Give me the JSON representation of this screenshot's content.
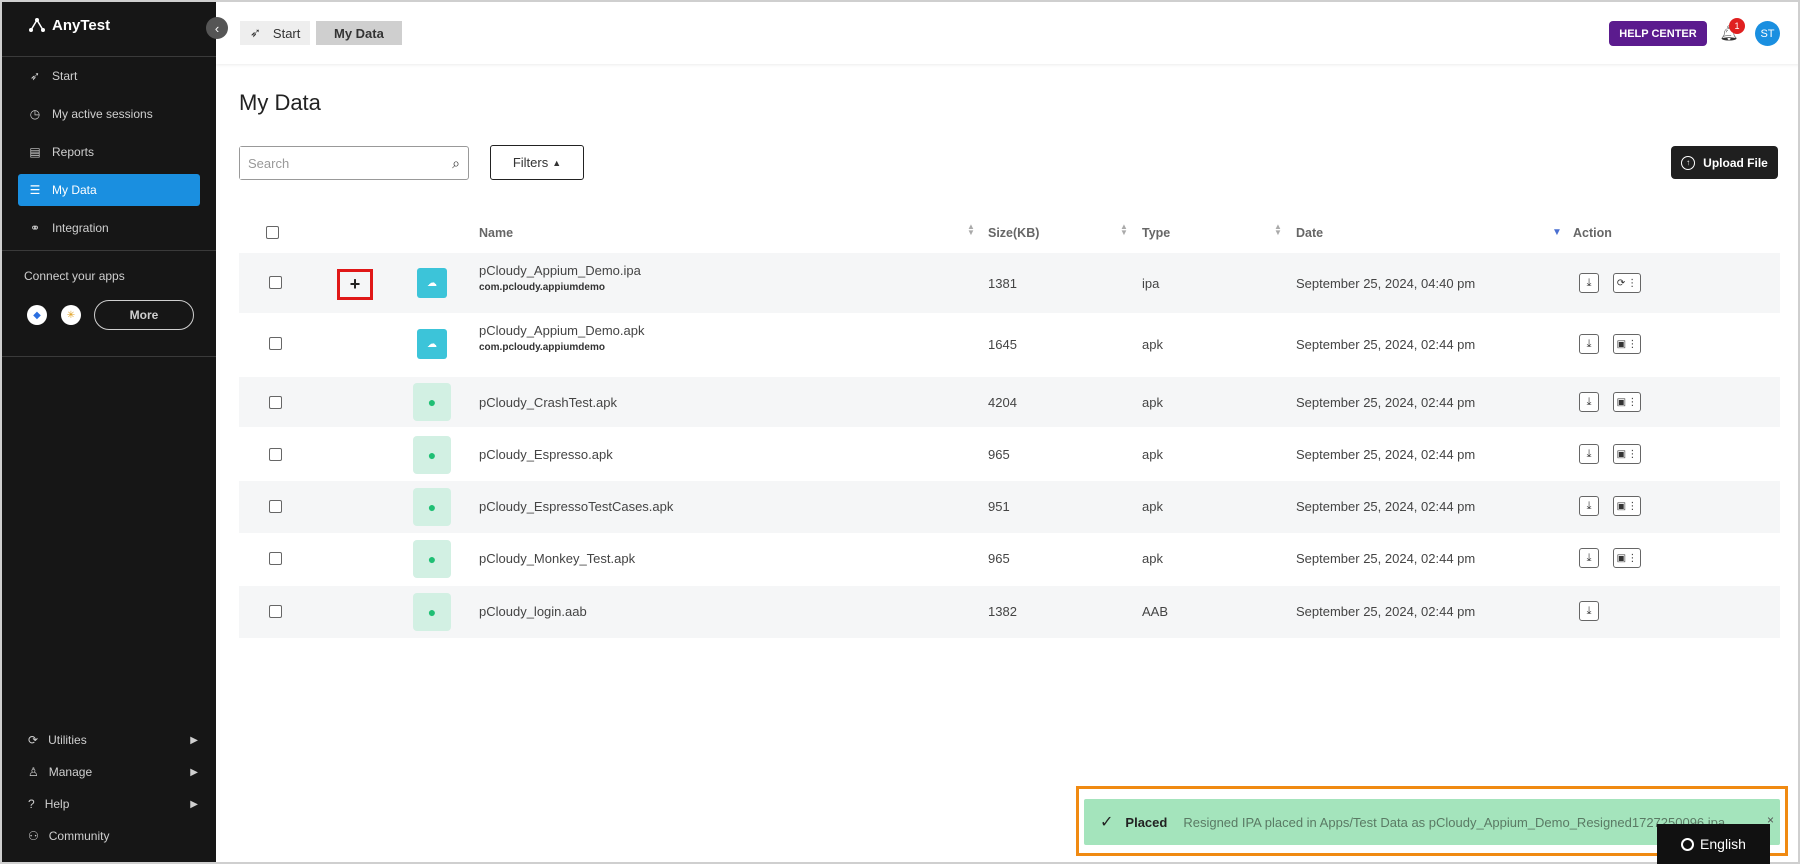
{
  "app": {
    "brand": "AnyTest",
    "accent": "#1a8fe0"
  },
  "sidebar": {
    "items": [
      {
        "label": "Start",
        "icon": "rocket-icon"
      },
      {
        "label": "My active sessions",
        "icon": "clock-icon"
      },
      {
        "label": "Reports",
        "icon": "report-icon"
      },
      {
        "label": "My Data",
        "icon": "database-icon",
        "active": true
      },
      {
        "label": "Integration",
        "icon": "integration-icon"
      }
    ],
    "connect_label": "Connect your apps",
    "more_label": "More",
    "bottom": [
      {
        "label": "Utilities",
        "icon": "utilities-icon"
      },
      {
        "label": "Manage",
        "icon": "user-icon"
      },
      {
        "label": "Help",
        "icon": "help-icon"
      },
      {
        "label": "Community",
        "icon": "community-icon"
      }
    ]
  },
  "header": {
    "breadcrumb": {
      "start": "Start",
      "current": "My Data"
    },
    "help_center": "HELP CENTER",
    "notifications": "1",
    "avatar": "ST",
    "help_color": "#5b1b8e"
  },
  "main": {
    "title": "My Data",
    "search_placeholder": "Search",
    "filters": "Filters",
    "upload": "Upload File"
  },
  "table": {
    "columns": {
      "name": "Name",
      "size": "Size(KB)",
      "type": "Type",
      "date": "Date",
      "action": "Action"
    },
    "rows": [
      {
        "name": "pCloudy_Appium_Demo.ipa",
        "package": "com.pcloudy.appiumdemo",
        "size": "1381",
        "type": "ipa",
        "date": "September 25, 2024, 04:40 pm",
        "icon": "cloud"
      },
      {
        "name": "pCloudy_Appium_Demo.apk",
        "package": "com.pcloudy.appiumdemo",
        "size": "1645",
        "type": "apk",
        "date": "September 25, 2024, 02:44 pm",
        "icon": "cloud"
      },
      {
        "name": "pCloudy_CrashTest.apk",
        "size": "4204",
        "type": "apk",
        "date": "September 25, 2024, 02:44 pm",
        "icon": "android"
      },
      {
        "name": "pCloudy_Espresso.apk",
        "size": "965",
        "type": "apk",
        "date": "September 25, 2024, 02:44 pm",
        "icon": "android"
      },
      {
        "name": "pCloudy_EspressoTestCases.apk",
        "size": "951",
        "type": "apk",
        "date": "September 25, 2024, 02:44 pm",
        "icon": "android"
      },
      {
        "name": "pCloudy_Monkey_Test.apk",
        "size": "965",
        "type": "apk",
        "date": "September 25, 2024, 02:44 pm",
        "icon": "android"
      },
      {
        "name": "pCloudy_login.aab",
        "size": "1382",
        "type": "AAB",
        "date": "September 25, 2024, 02:44 pm",
        "icon": "android"
      }
    ],
    "plus_label": "+"
  },
  "toast": {
    "title": "Placed",
    "message": "Resigned IPA placed in Apps/Test Data as pCloudy_Appium_Demo_Resigned1727250096.ipa",
    "close": "×",
    "bg": "#a4e4bc"
  },
  "language": "English"
}
